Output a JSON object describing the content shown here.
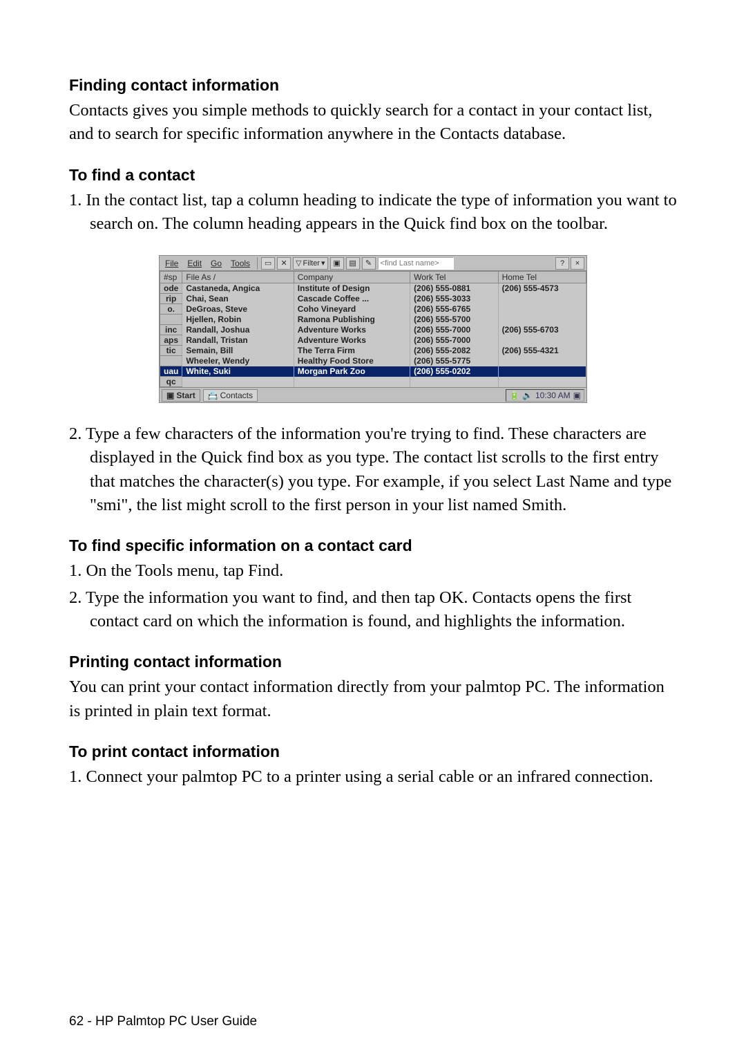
{
  "section1": {
    "heading": "Finding contact information",
    "para": "Contacts gives you simple methods to quickly search for a contact in your contact list, and to search for specific information anywhere in the Contacts database."
  },
  "section2": {
    "heading": "To find a contact",
    "item1": "1. In the contact list, tap a column heading to indicate the type of information you want to search on. The column heading appears in the Quick find box on the toolbar.",
    "item2": "2. Type a few characters of the information you're trying to find. These characters are displayed in the Quick find box as you type. The contact list scrolls to the first entry that matches the character(s) you type. For example, if you select Last Name and type \"smi\", the list might scroll to the first person in your list named Smith."
  },
  "section3": {
    "heading": "To find specific information on a contact card",
    "item1": "1. On the Tools menu, tap Find.",
    "item2": "2. Type the information you want to find, and then tap OK. Contacts opens the first contact card on which the information is found, and highlights the information."
  },
  "section4": {
    "heading": "Printing contact information",
    "para": "You can print your contact information directly from your palmtop PC. The information is printed in plain text format."
  },
  "section5": {
    "heading": "To print contact information",
    "item1": "1. Connect your palmtop PC to a printer using a serial cable or an infrared connection."
  },
  "screenshot": {
    "menu": {
      "file": "File",
      "edit": "Edit",
      "go": "Go",
      "tools": "Tools"
    },
    "filter_label": "Filter",
    "find_placeholder": "<find Last name>",
    "help": "?",
    "close": "×",
    "columns": {
      "cat": "#sp",
      "fileas": "File As  /",
      "company": "Company",
      "worktel": "Work Tel",
      "hometel": "Home Tel"
    },
    "rows": [
      {
        "icon": "ode",
        "fileas": "Castaneda, Angica",
        "company": "Institute of Design",
        "worktel": "(206) 555-0881",
        "hometel": "(206) 555-4573"
      },
      {
        "icon": "rip",
        "fileas": "Chai, Sean",
        "company": "Cascade Coffee ...",
        "worktel": "(206) 555-3033",
        "hometel": ""
      },
      {
        "icon": "o.",
        "fileas": "DeGroas, Steve",
        "company": "Coho Vineyard",
        "worktel": "(206) 555-6765",
        "hometel": ""
      },
      {
        "icon": "",
        "fileas": "Hjellen, Robin",
        "company": "Ramona Publishing",
        "worktel": "(206) 555-5700",
        "hometel": ""
      },
      {
        "icon": "inc",
        "fileas": "Randall, Joshua",
        "company": "Adventure Works",
        "worktel": "(206) 555-7000",
        "hometel": "(206) 555-6703"
      },
      {
        "icon": "aps",
        "fileas": "Randall, Tristan",
        "company": "Adventure Works",
        "worktel": "(206) 555-7000",
        "hometel": ""
      },
      {
        "icon": "tic",
        "fileas": "Semain, Bill",
        "company": "The Terra Firm",
        "worktel": "(206) 555-2082",
        "hometel": "(206) 555-4321"
      },
      {
        "icon": "",
        "fileas": "Wheeler, Wendy",
        "company": "Healthy Food Store",
        "worktel": "(206) 555-5775",
        "hometel": ""
      },
      {
        "icon": "uau",
        "fileas": "White, Suki",
        "company": "Morgan Park Zoo",
        "worktel": "(206) 555-0202",
        "hometel": ""
      }
    ],
    "blankicon": "qc",
    "start": "Start",
    "taskapp": "Contacts",
    "clock": "10:30 AM"
  },
  "footer": "62 - HP Palmtop PC User Guide"
}
